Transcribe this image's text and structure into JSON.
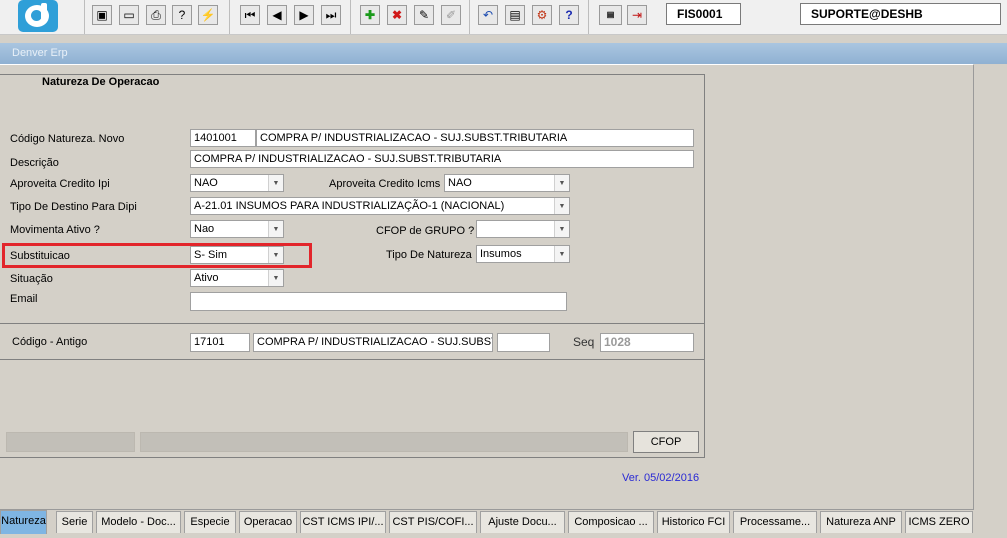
{
  "toolbar": {
    "form_code": "FIS0001",
    "user": "SUPORTE@DESHB",
    "icons": [
      "save-icon",
      "window-icon",
      "print-icon",
      "query-icon",
      "execute-query-icon",
      "first-record-icon",
      "previous-record-icon",
      "next-record-icon",
      "last-record-icon",
      "insert-record-icon",
      "delete-record-icon",
      "edit-record-icon",
      "clear-icon",
      "undo-icon",
      "clipboard-icon",
      "tools-icon",
      "help-icon",
      "menu-icon",
      "exit-icon"
    ]
  },
  "window": {
    "title": "Denver Erp"
  },
  "form": {
    "section_title": "Natureza De Operacao",
    "codigo_natureza": {
      "label": "Código Natureza. Novo",
      "code": "1401001",
      "desc": "COMPRA P/ INDUSTRIALIZACAO - SUJ.SUBST.TRIBUTARIA"
    },
    "descricao": {
      "label": "Descrição",
      "value": "COMPRA P/ INDUSTRIALIZACAO - SUJ.SUBST.TRIBUTARIA"
    },
    "aproveita_ipi": {
      "label": "Aproveita Credito Ipi",
      "value": "NAO"
    },
    "aproveita_icms": {
      "label": "Aproveita Credito Icms",
      "value": "NAO"
    },
    "tipo_destino_dipi": {
      "label": "Tipo De Destino Para Dipi",
      "value": "A-21.01 INSUMOS PARA INDUSTRIALIZAÇÃO-1 (NACIONAL)"
    },
    "movimenta_ativo": {
      "label": "Movimenta Ativo ?",
      "value": "Nao"
    },
    "cfop_grupo": {
      "label": "CFOP de GRUPO ?",
      "value": ""
    },
    "substituicao": {
      "label": "Substituicao",
      "value": "S- Sim"
    },
    "tipo_natureza": {
      "label": "Tipo De Natureza",
      "value": "Insumos"
    },
    "situacao": {
      "label": "Situação",
      "value": "Ativo"
    },
    "email": {
      "label": "Email",
      "value": ""
    },
    "codigo_antigo": {
      "label": "Código - Antigo",
      "code": "17101",
      "desc": "COMPRA P/ INDUSTRIALIZACAO - SUJ.SUBST.TF",
      "extra": ""
    },
    "seq": {
      "label": "Seq",
      "value": "1028"
    },
    "cfop_button": "CFOP",
    "version": "Ver. 05/02/2016"
  },
  "tabs": [
    "Natureza",
    "Serie",
    "Modelo - Doc...",
    "Especie",
    "Operacao",
    "CST ICMS IPI/...",
    "CST PIS/COFI...",
    "Ajuste Docu...",
    "Composicao ...",
    "Historico FCI",
    "Processame...",
    "Natureza ANP",
    "ICMS ZERO"
  ],
  "active_tab": "Natureza"
}
